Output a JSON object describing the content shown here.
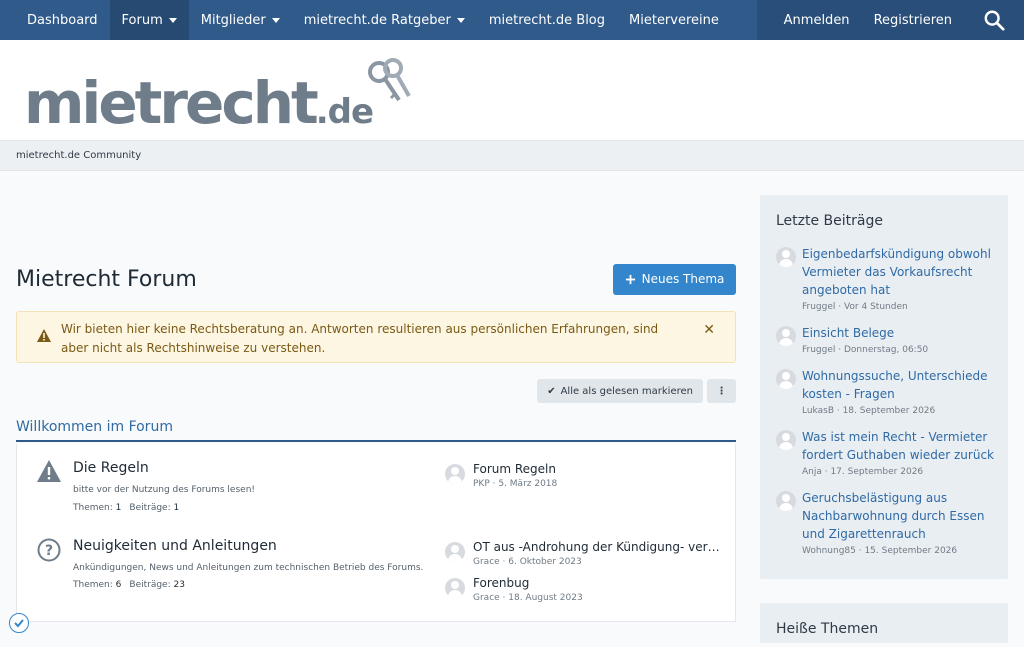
{
  "nav": {
    "items": [
      {
        "label": "Dashboard",
        "caret": false
      },
      {
        "label": "Forum",
        "caret": true,
        "active": true
      },
      {
        "label": "Mitglieder",
        "caret": true
      },
      {
        "label": "mietrecht.de Ratgeber",
        "caret": true
      },
      {
        "label": "mietrecht.de Blog",
        "caret": false
      },
      {
        "label": "Mietervereine",
        "caret": false
      }
    ],
    "login": "Anmelden",
    "register": "Registrieren",
    "search_icon": "search-icon"
  },
  "logo": {
    "main": "mietrecht",
    "domain": ".de",
    "icon": "keys-icon"
  },
  "breadcrumb": "mietrecht.de Community",
  "page": {
    "title": "Mietrecht Forum",
    "new_thread": "Neues Thema",
    "notice": "Wir bieten hier keine Rechtsberatung an. Antworten resultieren aus persönlichen Erfahrungen, sind aber nicht als Rechtshinweise zu verstehen.",
    "mark_read": "Alle als gelesen markieren",
    "category": "Willkommen im Forum"
  },
  "forums": [
    {
      "name": "Die Regeln",
      "desc": "bitte vor der Nutzung des Forums lesen!",
      "threads_label": "Themen:",
      "threads": "1",
      "posts_label": "Beiträge:",
      "posts": "1",
      "icon": "warning-icon",
      "latest": [
        {
          "title": "Forum Regeln",
          "meta": "PKP · 5. März 2018"
        }
      ]
    },
    {
      "name": "Neuigkeiten und Anleitungen",
      "desc": "Ankündigungen, News und Anleitungen zum technischen Betrieb des Forums.",
      "threads_label": "Themen:",
      "threads": "6",
      "posts_label": "Beiträge:",
      "posts": "23",
      "icon": "question-icon",
      "latest": [
        {
          "title": "OT aus -Androhung der Kündigung- versc…",
          "meta": "Grace · 6. Oktober 2023"
        },
        {
          "title": "Forenbug",
          "meta": "Grace · 18. August 2023"
        }
      ]
    }
  ],
  "sidebar": {
    "latest_title": "Letzte Beiträge",
    "posts": [
      {
        "title": "Eigenbedarfskündigung obwohl Vermieter das Vorkaufsrecht angeboten hat",
        "meta": "Fruggel · Vor 4 Stunden"
      },
      {
        "title": "Einsicht Belege",
        "meta": "Fruggel · Donnerstag, 06:50"
      },
      {
        "title": "Wohnungssuche, Unterschiede kosten - Fragen",
        "meta": "LukasB · 18. September 2026"
      },
      {
        "title": "Was ist mein Recht - Vermieter fordert Guthaben wieder zurück",
        "meta": "Anja · 17. September 2026"
      },
      {
        "title": "Geruchsbelästigung aus Nachbarwohnung durch Essen und Zigarettenrauch",
        "meta": "Wohnung85 · 15. September 2026"
      }
    ],
    "hot_title": "Heiße Themen"
  },
  "colors": {
    "nav": "#2f5a8a",
    "accent": "#3386cc",
    "link": "#2f6aa5"
  }
}
